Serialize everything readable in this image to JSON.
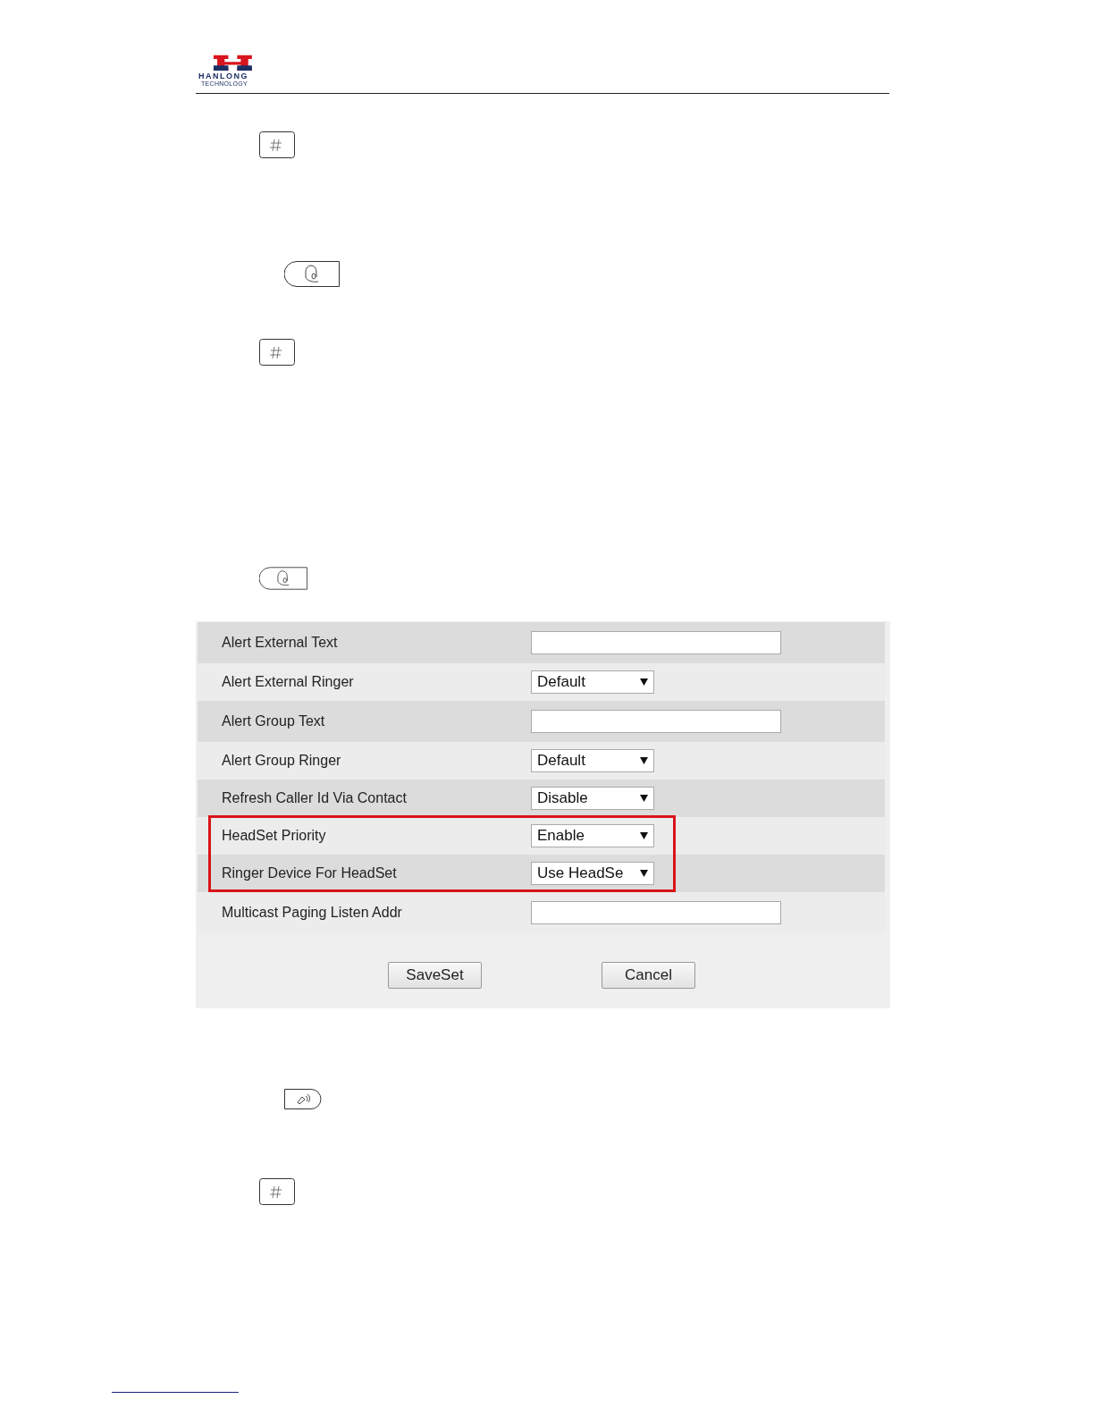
{
  "header": {
    "brand": "HANLONG",
    "tagline": "TECHNOLOGY"
  },
  "keys": [
    {
      "kind": "hash"
    },
    {
      "kind": "headset"
    },
    {
      "kind": "hash"
    },
    {
      "kind": "headset"
    },
    {
      "kind": "speaker"
    },
    {
      "kind": "hash"
    }
  ],
  "form": {
    "rows": [
      {
        "label": "Alert External Text",
        "kind": "text",
        "highlighted": false
      },
      {
        "label": "Alert External Ringer",
        "kind": "select",
        "value": "Default",
        "highlighted": false
      },
      {
        "label": "Alert Group Text",
        "kind": "text",
        "highlighted": false
      },
      {
        "label": "Alert Group Ringer",
        "kind": "select",
        "value": "Default",
        "highlighted": false
      },
      {
        "label": "Refresh Caller Id Via Contact",
        "kind": "select",
        "value": "Disable",
        "highlighted": false
      },
      {
        "label": "HeadSet Priority",
        "kind": "select",
        "value": "Enable",
        "highlighted": true
      },
      {
        "label": "Ringer Device For HeadSet",
        "kind": "select",
        "value": "Use HeadSe",
        "highlighted": true
      },
      {
        "label": "Multicast Paging Listen Addr",
        "kind": "text",
        "highlighted": false
      }
    ],
    "buttons": [
      "SaveSet",
      "Cancel"
    ]
  }
}
